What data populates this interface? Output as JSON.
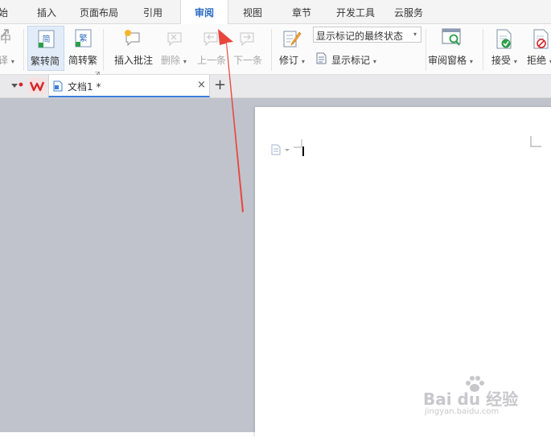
{
  "menu": {
    "partial_first": "始",
    "tabs": [
      "插入",
      "页面布局",
      "引用",
      "审阅",
      "视图",
      "章节",
      "开发工具",
      "云服务"
    ],
    "active_tab": "审阅"
  },
  "ribbon": {
    "partial_left_big": "中",
    "partial_left_label": "译",
    "trad_to_simp": "繁转简",
    "trad_icon_glyph": "简",
    "simp_to_trad": "简转繁",
    "simp_icon_glyph": "繁",
    "insert_comment": "插入批注",
    "delete": "删除",
    "previous": "上一条",
    "next": "下一条",
    "track_changes": "修订",
    "markup_select_value": "显示标记的最终状态",
    "show_markup": "显示标记",
    "review_pane": "审阅窗格",
    "accept": "接受",
    "reject": "拒绝"
  },
  "doc_tabs": {
    "document_name": "文档1 *",
    "new_tab_symbol": "+",
    "close_symbol": "×"
  },
  "watermark": {
    "brand": "Bai du 经验",
    "url": "jingyan.baidu.com"
  },
  "colors": {
    "active_tab_text": "#2b6cc4",
    "arrow": "#e8453c",
    "workspace": "#c0c3cb",
    "wps_logo": "#d8262a"
  }
}
